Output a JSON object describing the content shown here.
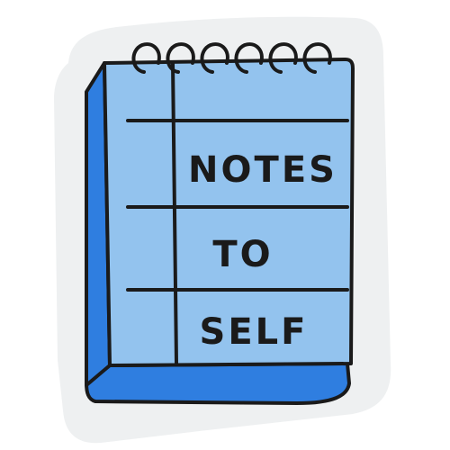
{
  "notepad": {
    "lines": [
      "NOTES",
      "TO",
      "SELF"
    ]
  },
  "colors": {
    "background": "#ffffff",
    "sticker_border": "#eef0f1",
    "page_fill": "#93c3ee",
    "pad_side": "#2f7ee0",
    "outline": "#1a1a1a"
  },
  "icons": {
    "binding": "spiral-ring-icon"
  }
}
